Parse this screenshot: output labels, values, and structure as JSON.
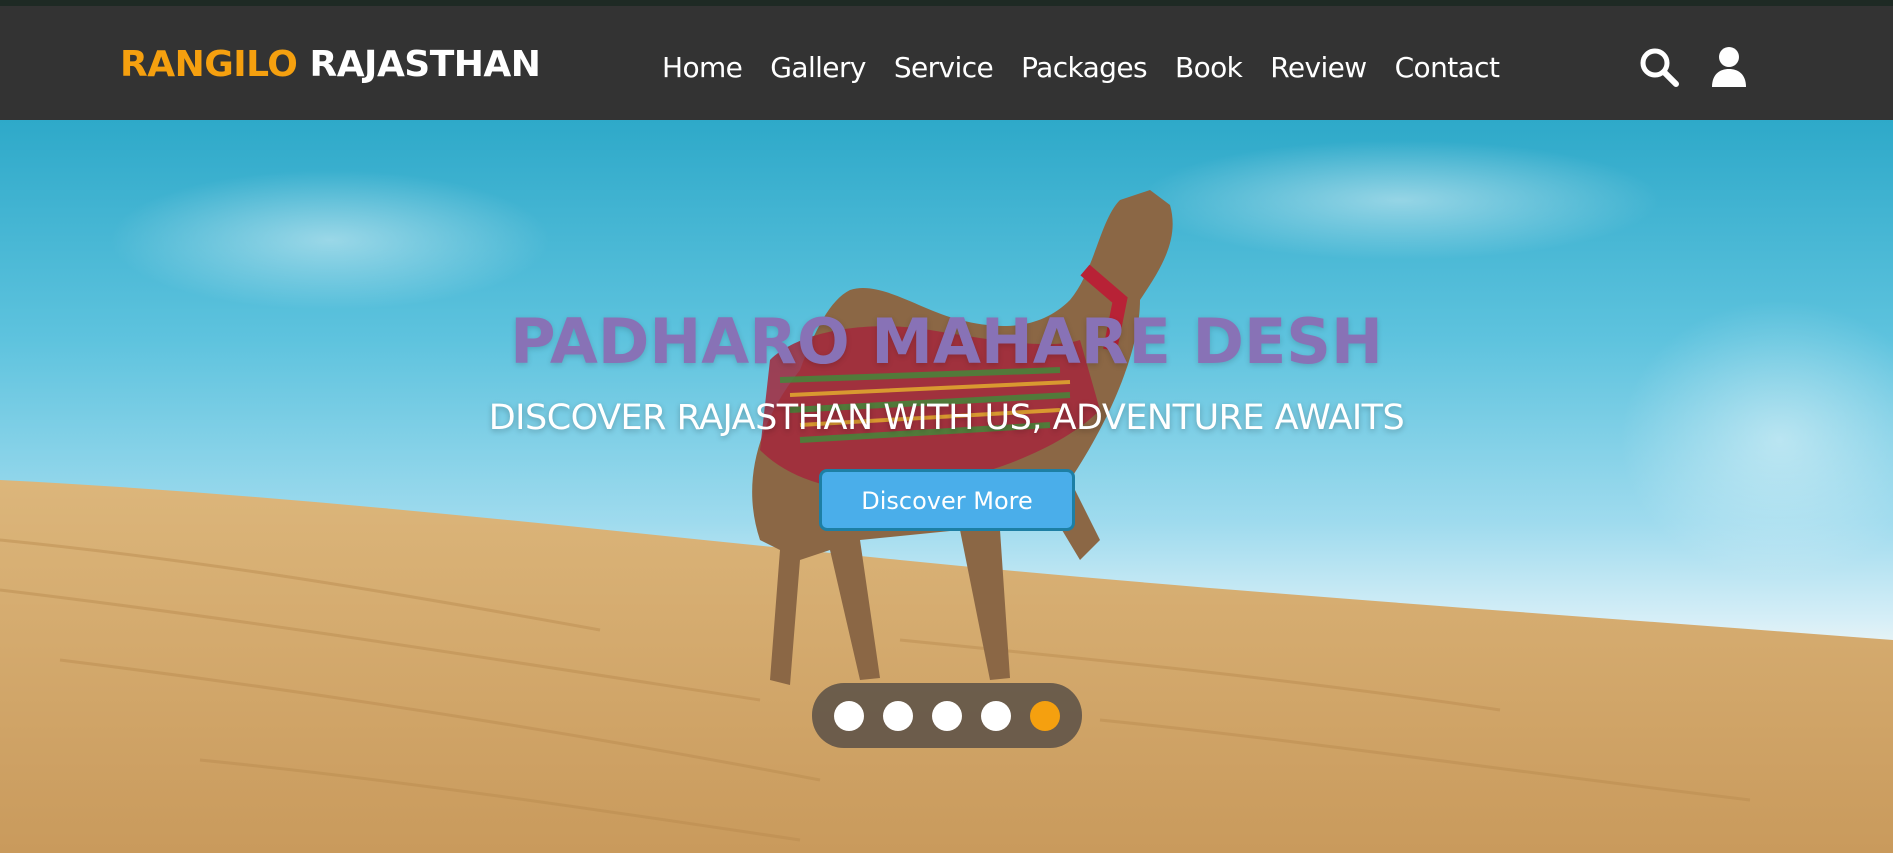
{
  "brand": {
    "accent_word": "RANGILO",
    "main_word": "RAJASTHAN",
    "accent_color": "#f5a00f"
  },
  "nav": {
    "items": [
      {
        "label": "Home"
      },
      {
        "label": "Gallery"
      },
      {
        "label": "Service"
      },
      {
        "label": "Packages"
      },
      {
        "label": "Book"
      },
      {
        "label": "Review"
      },
      {
        "label": "Contact"
      }
    ],
    "icons": [
      "search-icon",
      "user-icon"
    ]
  },
  "hero": {
    "title": "PADHARO MAHARE DESH",
    "subtitle": "DISCOVER RAJASTHAN WITH US, ADVENTURE AWAITS",
    "button_label": "Discover More",
    "title_color": "#8872b6",
    "button_color": "#4aaeea",
    "slides_count": 5,
    "active_slide": 5
  }
}
